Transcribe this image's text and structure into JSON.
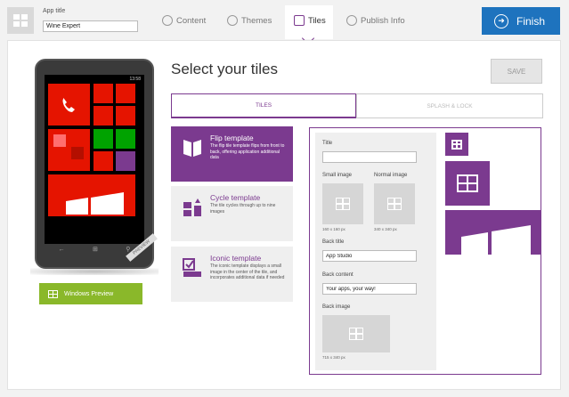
{
  "header": {
    "app_title_label": "App title",
    "app_title_value": "Wine Expert",
    "tabs": [
      {
        "label": "Content",
        "icon": "content-icon"
      },
      {
        "label": "Themes",
        "icon": "themes-icon"
      },
      {
        "label": "Tiles",
        "icon": "tiles-icon",
        "active": true
      },
      {
        "label": "Publish Info",
        "icon": "globe-icon"
      }
    ],
    "finish_label": "Finish"
  },
  "phone": {
    "status_time": "13:58",
    "preview_ribbon": "PREVIEW",
    "windows_preview_label": "Windows Preview"
  },
  "main": {
    "section_title": "Select your tiles",
    "save_label": "SAVE",
    "tabs": [
      "TILES",
      "SPLASH & LOCK"
    ],
    "templates": [
      {
        "title": "Flip template",
        "desc": "The flip tile template flips from front to back, offering application additional data",
        "selected": true
      },
      {
        "title": "Cycle template",
        "desc": "The tile cycles through up to nine images",
        "selected": false
      },
      {
        "title": "Iconic template",
        "desc": "The iconic template displays a small image in the center of the tile, and incorporates additional data if needed",
        "selected": false
      }
    ]
  },
  "editor": {
    "title_label": "Title",
    "title_value": "",
    "small_image_label": "Small image",
    "small_image_dim": "160 x 160 px",
    "normal_image_label": "Normal image",
    "normal_image_dim": "340 x 340 px",
    "back_title_label": "Back title",
    "back_title_value": "App Studio",
    "back_content_label": "Back content",
    "back_content_value": "Your apps, your way!",
    "back_image_label": "Back image",
    "back_image_dim": "715 x 340 px"
  },
  "colors": {
    "accent": "#7b3a8f",
    "finish": "#1e73be",
    "windows_preview": "#8ab82a",
    "phone_tile_red": "#e51400"
  }
}
